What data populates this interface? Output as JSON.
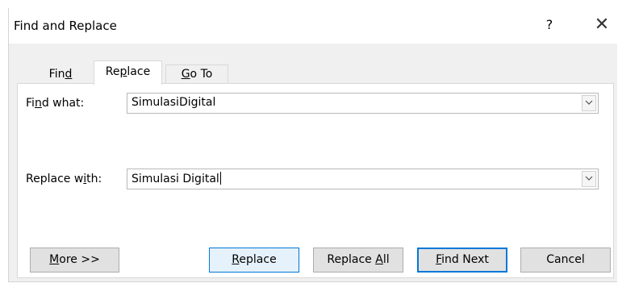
{
  "window": {
    "title": "Find and Replace",
    "help": "?",
    "close_icon": "close-icon"
  },
  "tabs": [
    {
      "pre": "Fin",
      "key": "d",
      "post": "",
      "active": false
    },
    {
      "pre": "Re",
      "key": "p",
      "post": "lace",
      "active": true
    },
    {
      "pre": "",
      "key": "G",
      "post": "o To",
      "active": false
    }
  ],
  "find": {
    "label_pre": "Fi",
    "label_key": "n",
    "label_post": "d what:",
    "value": "SimulasiDigital"
  },
  "replace": {
    "label_pre": "Replace w",
    "label_key": "i",
    "label_post": "th:",
    "value": "Simulasi Digital"
  },
  "buttons": {
    "more": {
      "pre": "",
      "key": "M",
      "post": "ore >>"
    },
    "replace": {
      "pre": "",
      "key": "R",
      "post": "eplace"
    },
    "replace_all": {
      "pre": "Replace ",
      "key": "A",
      "post": "ll"
    },
    "find_next": {
      "pre": "",
      "key": "F",
      "post": "ind Next"
    },
    "cancel": {
      "label": "Cancel"
    }
  }
}
